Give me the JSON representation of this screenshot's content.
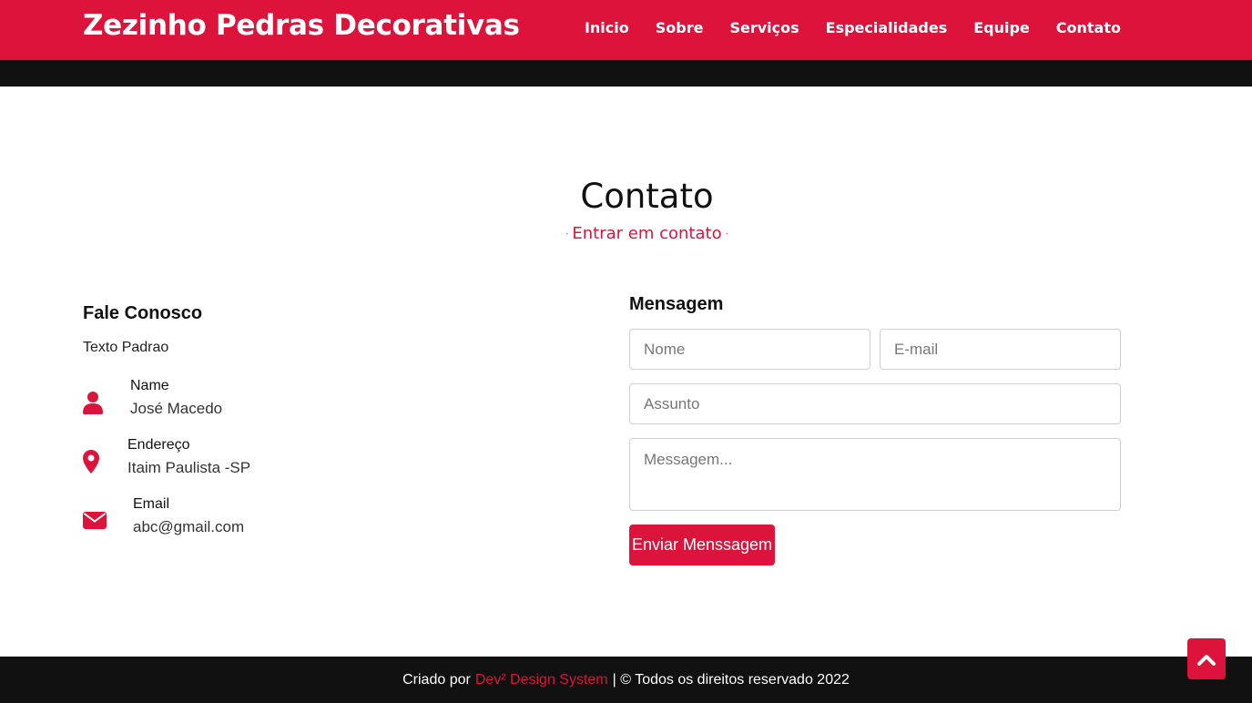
{
  "brand": {
    "name": "Zezinho Pedras Decorativas"
  },
  "nav": {
    "items": [
      "Inicio",
      "Sobre",
      "Serviços",
      "Especialidades",
      "Equipe",
      "Contato"
    ]
  },
  "section": {
    "title": "Contato",
    "subtitle": "Entrar em contato"
  },
  "contact_info": {
    "title": "Fale Conosco",
    "text": "Texto Padrao",
    "items": [
      {
        "icon": "user-icon",
        "label": "Name",
        "value": "José Macedo"
      },
      {
        "icon": "map-pin-icon",
        "label": "Endereço",
        "value": "Itaim Paulista -SP"
      },
      {
        "icon": "envelope-icon",
        "label": "Email",
        "value": "abc@gmail.com"
      }
    ]
  },
  "form": {
    "title": "Mensagem",
    "name_placeholder": "Nome",
    "email_placeholder": "E-mail",
    "subject_placeholder": "Assunto",
    "message_placeholder": "Messagem...",
    "submit_label": "Enviar Menssagem"
  },
  "footer": {
    "prefix": "Criado por",
    "credit": "Dev² Design System",
    "rest": "| © Todos os direitos reservado 2022"
  },
  "colors": {
    "accent": "#dc143c",
    "dark": "#111111"
  },
  "back_to_top": {
    "icon": "chevron-up-icon"
  }
}
